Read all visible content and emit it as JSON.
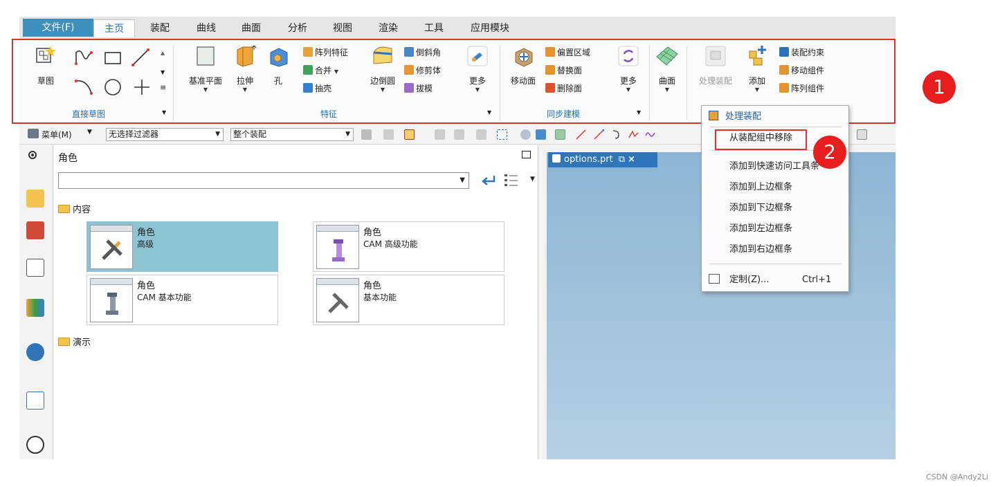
{
  "menubar": {
    "file_tab": "文件(F)",
    "tabs": [
      "主页",
      "装配",
      "曲线",
      "曲面",
      "分析",
      "视图",
      "渲染",
      "工具",
      "应用模块"
    ]
  },
  "ribbon": {
    "sketch": "草图",
    "direct_sketch_label": "直接草图",
    "datum_plane": "基准平面",
    "extrude": "拉伸",
    "hole": "孔",
    "pattern_feature": "阵列特征",
    "unite": "合并",
    "shell": "抽壳",
    "edge_blend": "边倒圆",
    "chamfer": "倒斜角",
    "trim_body": "修剪体",
    "draft": "拔模",
    "more1": "更多",
    "feature_label": "特征",
    "move_face": "移动面",
    "offset_region": "偏置区域",
    "replace_face": "替换面",
    "delete_face": "删除面",
    "more2": "更多",
    "sync_label": "同步建模",
    "surface": "曲面",
    "process_assembly": "处理装配",
    "add": "添加",
    "assembly_constraint": "装配约束",
    "move_component": "移动组件",
    "pattern_component": "阵列组件"
  },
  "toolbar": {
    "menu": "菜单(M)",
    "filter": "无选择过滤器",
    "scope": "整个装配"
  },
  "panel": {
    "title": "角色",
    "folder_content": "内容",
    "folder_demo": "演示",
    "cards": [
      {
        "title": "角色",
        "subtitle": "高级"
      },
      {
        "title": "角色",
        "subtitle": "CAM 高级功能"
      },
      {
        "title": "角色",
        "subtitle": "CAM 基本功能"
      },
      {
        "title": "角色",
        "subtitle": "基本功能"
      }
    ]
  },
  "graphics": {
    "tab_label": "options.prt"
  },
  "context_menu": {
    "header": "处理装配",
    "remove_from_group": "从装配组中移除",
    "add_quick_access": "添加到快速访问工具条",
    "add_top": "添加到上边框条",
    "add_bottom": "添加到下边框条",
    "add_left": "添加到左边框条",
    "add_right": "添加到右边框条",
    "customize": "定制(Z)...",
    "customize_shortcut": "Ctrl+1"
  },
  "annotations": {
    "badge1": "1",
    "badge2": "2",
    "watermark": "CSDN @Andy2Li"
  },
  "colors": {
    "accent_blue": "#3d8fbd",
    "highlight_red": "#e0302a",
    "selected_card": "#8cc4d3"
  }
}
